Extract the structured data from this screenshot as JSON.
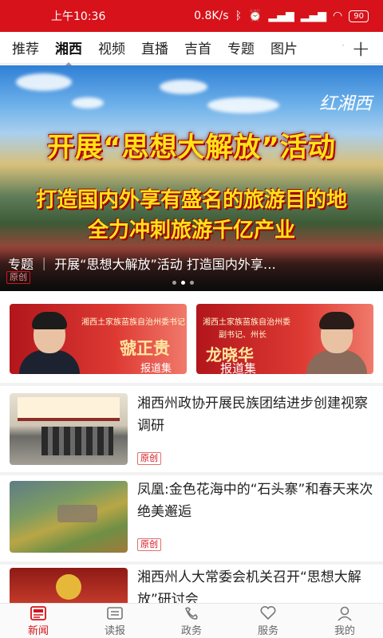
{
  "status": {
    "time": "上午10:36",
    "speed": "0.8K/s",
    "battery": "90"
  },
  "tabs": [
    {
      "label": "推荐"
    },
    {
      "label": "湘西"
    },
    {
      "label": "视频"
    },
    {
      "label": "直播"
    },
    {
      "label": "吉首"
    },
    {
      "label": "专题"
    },
    {
      "label": "图片"
    }
  ],
  "banner": {
    "logo": "红湘西",
    "title": "开展“思想大解放”活动",
    "line1": "打造国内外享有盛名的旅游目的地",
    "line2": "全力冲刺旅游千亿产业",
    "caption": "专题 ｜ 开展“思想大解放”活动 打造国内外享…",
    "tag": "原创"
  },
  "leaders": [
    {
      "subtitle": "湘西土家族苗族自治州委书记",
      "name": "虢正贵",
      "label": "报道集"
    },
    {
      "subtitle": "湘西土家族苗族自治州委",
      "subtitle2": "副书记、州长",
      "name": "龙晓华",
      "label": "报道集"
    }
  ],
  "news": [
    {
      "title": "湘西州政协开展民族团结进步创建视察调研",
      "tag": "原创"
    },
    {
      "title": "凤凰:金色花海中的“石头寨”和春天来次绝美邂逅",
      "tag": "原创"
    },
    {
      "title": "湘西州人大常委会机关召开“思想大解放”研讨会"
    }
  ],
  "bottom_nav": [
    {
      "label": "新闻",
      "icon": "news-icon"
    },
    {
      "label": "读报",
      "icon": "newspaper-icon"
    },
    {
      "label": "政务",
      "icon": "government-icon"
    },
    {
      "label": "服务",
      "icon": "service-heart-icon"
    },
    {
      "label": "我的",
      "icon": "user-icon"
    }
  ],
  "colors": {
    "brand_red": "#d7121a",
    "title_yellow": "#ffe21a"
  }
}
